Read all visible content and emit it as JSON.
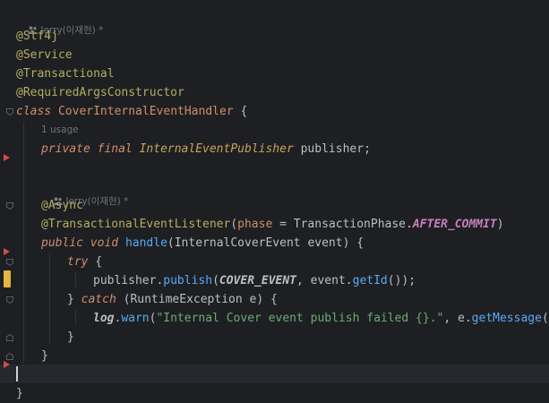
{
  "editor": {
    "author_hint_1": "Jerry(이재헌) *",
    "usage_hint": "1 usage",
    "author_hint_2": "Jerry(이재헌) *",
    "lines": {
      "l1": "@Slf4j",
      "l2": "@Service",
      "l3": "@Transactional",
      "l4": "@RequiredArgsConstructor",
      "l5_kw": "class",
      "l5_name": "CoverInternalEventHandler",
      "l5_brace": " {",
      "l6_kw1": "private",
      "l6_kw2": "final",
      "l6_type": "InternalEventPublisher",
      "l6_field": "publisher",
      "l6_end": ";",
      "l7": "@Async",
      "l8_ann": "@TransactionalEventListener",
      "l8_open": "(",
      "l8_param": "phase",
      "l8_eq": " = TransactionPhase.",
      "l8_const": "AFTER_COMMIT",
      "l8_close": ")",
      "l9_kw1": "public",
      "l9_kw2": "void",
      "l9_method": "handle",
      "l9_args": "(InternalCoverEvent event) {",
      "l10_kw": "try",
      "l10_brace": " {",
      "l11_obj": "publisher.",
      "l11_call": "publish",
      "l11_open": "(",
      "l11_const": "COVER_EVENT",
      "l11_mid": ", event.",
      "l11_call2": "getId",
      "l11_end": "());",
      "l12_brace": "} ",
      "l12_kw": "catch",
      "l12_rest": " (RuntimeException e) {",
      "l13_log": "log",
      "l13_dot": ".",
      "l13_call": "warn",
      "l13_open": "(",
      "l13_str": "\"Internal Cover event publish failed {}.\"",
      "l13_mid": ", e.",
      "l13_call2": "getMessage",
      "l13_end": "());",
      "l14": "}",
      "l15": "}",
      "l17": "}"
    }
  },
  "colors": {
    "background": "#1e1f22",
    "annotation": "#b3ae60",
    "keyword": "#cf8e6d",
    "method": "#56a8f5",
    "string": "#6aab73",
    "constant": "#c77dbb",
    "interface": "#c6a35d",
    "gutter_arrow": "#c94f4f",
    "change_marker": "#e2b440"
  }
}
